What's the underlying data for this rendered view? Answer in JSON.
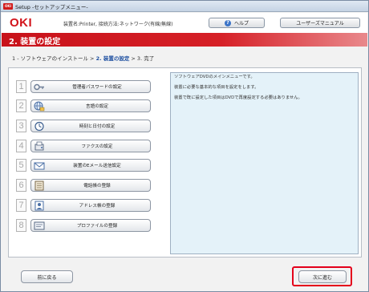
{
  "window": {
    "title": "Setup -セットアップメニュー-",
    "app_icon_text": "OKI"
  },
  "header": {
    "logo": "OKI",
    "model": "装置名:Printer, 接続方法:ネットワーク(有線/無線)",
    "help_label": "ヘルプ",
    "manual_label": "ユーザーズマニュアル"
  },
  "page": {
    "title": "2. 装置の設定"
  },
  "steps": {
    "step1": "1 - ソフトウェアのインストール >",
    "step2": "2. 装置の設定",
    "step3": "> 3. 完了"
  },
  "menu": {
    "items": [
      {
        "num": "1",
        "label": "管理者パスワードの設定",
        "icon": "key-icon"
      },
      {
        "num": "2",
        "label": "言語の設定",
        "icon": "globe-icon"
      },
      {
        "num": "3",
        "label": "時刻と日付の設定",
        "icon": "clock-icon"
      },
      {
        "num": "4",
        "label": "ファクスの設定",
        "icon": "fax-icon"
      },
      {
        "num": "5",
        "label": "装置のEメール送信設定",
        "icon": "email-icon"
      },
      {
        "num": "6",
        "label": "電話帳の登録",
        "icon": "phonebook-icon"
      },
      {
        "num": "7",
        "label": "アドレス帳の登録",
        "icon": "address-book-icon"
      },
      {
        "num": "8",
        "label": "プロファイルの登録",
        "icon": "profile-icon"
      }
    ]
  },
  "description": {
    "line1": "ソフトウェアDVDのメインメニューです。",
    "line2": "装置に必要な基本的な項目を設定をします。",
    "line3": "装置で既に設定した項目はDVDで再度設定する必要はありません。"
  },
  "footer": {
    "back_label": "前に戻る",
    "next_label": "次に進む",
    "highlight_color": "#e4001b"
  }
}
